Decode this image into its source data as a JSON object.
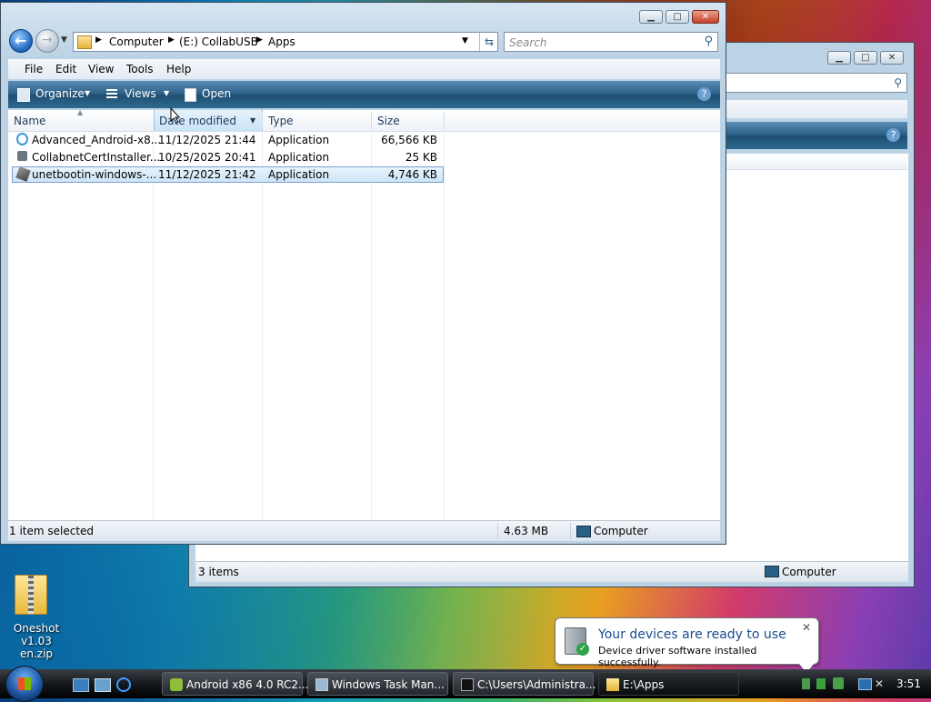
{
  "colors": {
    "accent": "#1f4f72",
    "selection": "#cde5f8",
    "link": "#1e395b"
  },
  "back_window": {
    "statusbar": {
      "items": "3 items",
      "location": "Computer"
    }
  },
  "front_window": {
    "address": {
      "crumbs": [
        "Computer",
        "(E:) CollabUSB",
        "Apps"
      ]
    },
    "search": {
      "placeholder": "Search"
    },
    "menu": [
      "File",
      "Edit",
      "View",
      "Tools",
      "Help"
    ],
    "toolbar": {
      "organize": "Organize",
      "views": "Views",
      "open": "Open"
    },
    "columns": [
      "Name",
      "Date modified",
      "Type",
      "Size"
    ],
    "files": [
      {
        "name": "Advanced_Android-x8...",
        "date": "11/12/2025 21:44",
        "type": "Application",
        "size": "66,566 KB",
        "icon": "android-installer-icon"
      },
      {
        "name": "CollabnetCertInstaller....",
        "date": "10/25/2025 20:41",
        "type": "Application",
        "size": "25 KB",
        "icon": "cert-installer-icon"
      },
      {
        "name": "unetbootin-windows-...",
        "date": "11/12/2025 21:42",
        "type": "Application",
        "size": "4,746 KB",
        "icon": "unetbootin-icon"
      }
    ],
    "statusbar": {
      "selection": "1 item selected",
      "size": "4.63 MB",
      "location": "Computer"
    }
  },
  "desktop": {
    "icon_label_1": "Oneshot",
    "icon_label_2": "v1.03 en.zip"
  },
  "taskbar": {
    "items": [
      {
        "label": "Android x86 4.0 RC2...",
        "icon": "android-icon"
      },
      {
        "label": "Windows Task Man...",
        "icon": "task-manager-icon"
      },
      {
        "label": "C:\\Users\\Administra...",
        "icon": "cmd-icon"
      },
      {
        "label": "E:\\Apps",
        "icon": "folder-icon"
      }
    ],
    "clock": "3:51"
  },
  "balloon": {
    "title": "Your devices are ready to use",
    "message": "Device driver software installed successfully."
  }
}
